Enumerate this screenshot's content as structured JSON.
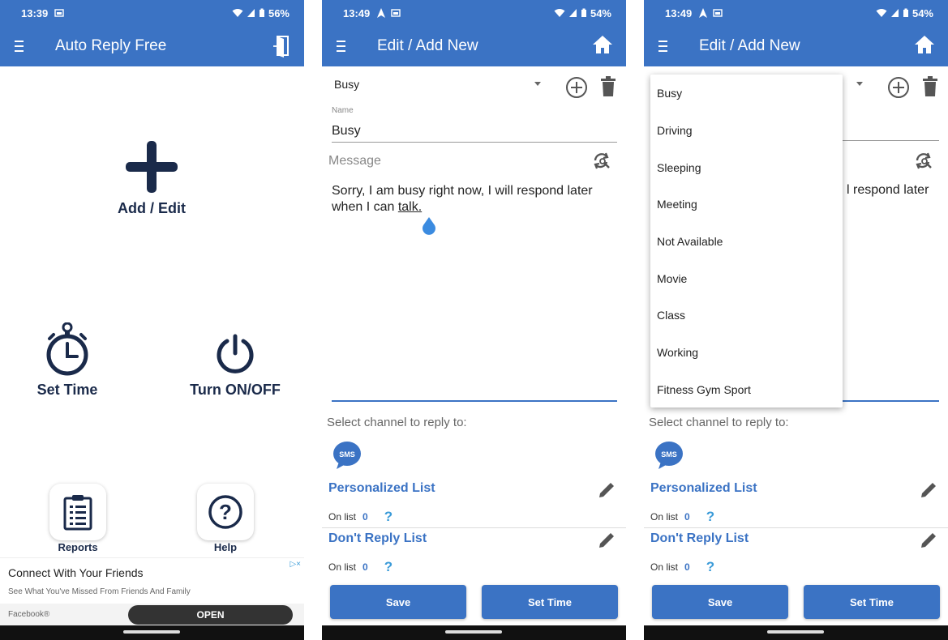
{
  "screen1": {
    "status": {
      "time": "13:39",
      "battery": "56%"
    },
    "title": "Auto Reply Free",
    "add_edit": "Add / Edit",
    "set_time": "Set Time",
    "turn_on_off": "Turn ON/OFF",
    "reports": "Reports",
    "help": "Help",
    "ad": {
      "title": "Connect With Your Friends",
      "subtitle": "See What You've Missed From Friends And Family",
      "source": "Facebook®",
      "button": "OPEN",
      "badge": "▷×"
    }
  },
  "screen2": {
    "status": {
      "time": "13:49",
      "battery": "54%"
    },
    "title": "Edit / Add New",
    "selected_preset": "Busy",
    "name_label": "Name",
    "name_value": "Busy",
    "message_label": "Message",
    "message_text": "Sorry, I am busy right now, I will respond later when I can ",
    "message_tail": "talk.",
    "channel_label": "Select channel to reply to:",
    "sms_label": "SMS",
    "personalized_list": {
      "title": "Personalized List",
      "on_list_label": "On list",
      "count": "0",
      "help": "?"
    },
    "dont_reply_list": {
      "title": "Don't Reply List",
      "on_list_label": "On list",
      "count": "0",
      "help": "?"
    },
    "save_button": "Save",
    "set_time_button": "Set Time"
  },
  "screen3": {
    "status": {
      "time": "13:49",
      "battery": "54%"
    },
    "title": "Edit / Add New",
    "visible_message_fragment": "l respond later",
    "dropdown_options": [
      "Busy",
      "Driving",
      "Sleeping",
      "Meeting",
      "Not Available",
      "Movie",
      "Class",
      "Working",
      "Fitness Gym Sport"
    ],
    "channel_label": "Select channel to reply to:",
    "sms_label": "SMS",
    "personalized_list": {
      "title": "Personalized List",
      "on_list_label": "On list",
      "count": "0",
      "help": "?"
    },
    "dont_reply_list": {
      "title": "Don't Reply List",
      "on_list_label": "On list",
      "count": "0",
      "help": "?"
    },
    "save_button": "Save",
    "set_time_button": "Set Time"
  },
  "colors": {
    "primary": "#3b73c4",
    "icon_dark": "#1a2a4a",
    "help_blue": "#3b9bd8"
  }
}
